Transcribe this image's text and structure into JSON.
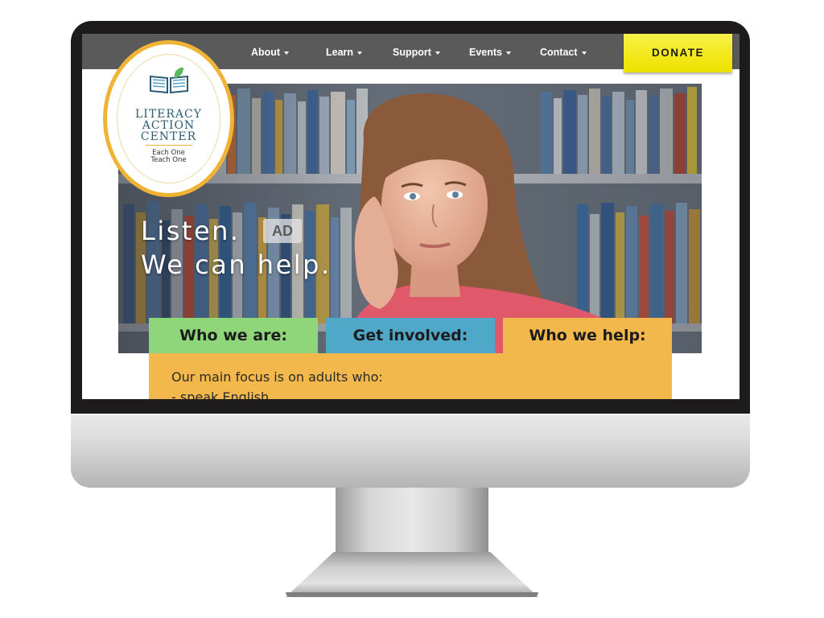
{
  "site": {
    "nav": [
      {
        "label": "About"
      },
      {
        "label": "Learn"
      },
      {
        "label": "Support"
      },
      {
        "label": "Events"
      },
      {
        "label": "Contact"
      }
    ],
    "donate_label": "DONATE",
    "logo": {
      "line1": "LITERACY",
      "line2": "ACTION",
      "line3": "CENTER",
      "tagline1": "Each One",
      "tagline2": "Teach One"
    },
    "hero": {
      "line1": "Listen.",
      "line2": "We can help.",
      "ad_badge": "AD"
    },
    "tabs": [
      {
        "label": "Who we are:",
        "color": "#8fd67a"
      },
      {
        "label": "Get involved:",
        "color": "#4fa8c8"
      },
      {
        "label": "Who we help:",
        "color": "#f2b84b"
      }
    ],
    "panel": {
      "line1": "Our main focus is on adults who:",
      "line2": "- speak English"
    }
  },
  "colors": {
    "nav_bg": "#5a5a5a",
    "donate_bg": "#f3e91c",
    "logo_ring": "#efb336",
    "panel_bg": "#f2b84b"
  }
}
